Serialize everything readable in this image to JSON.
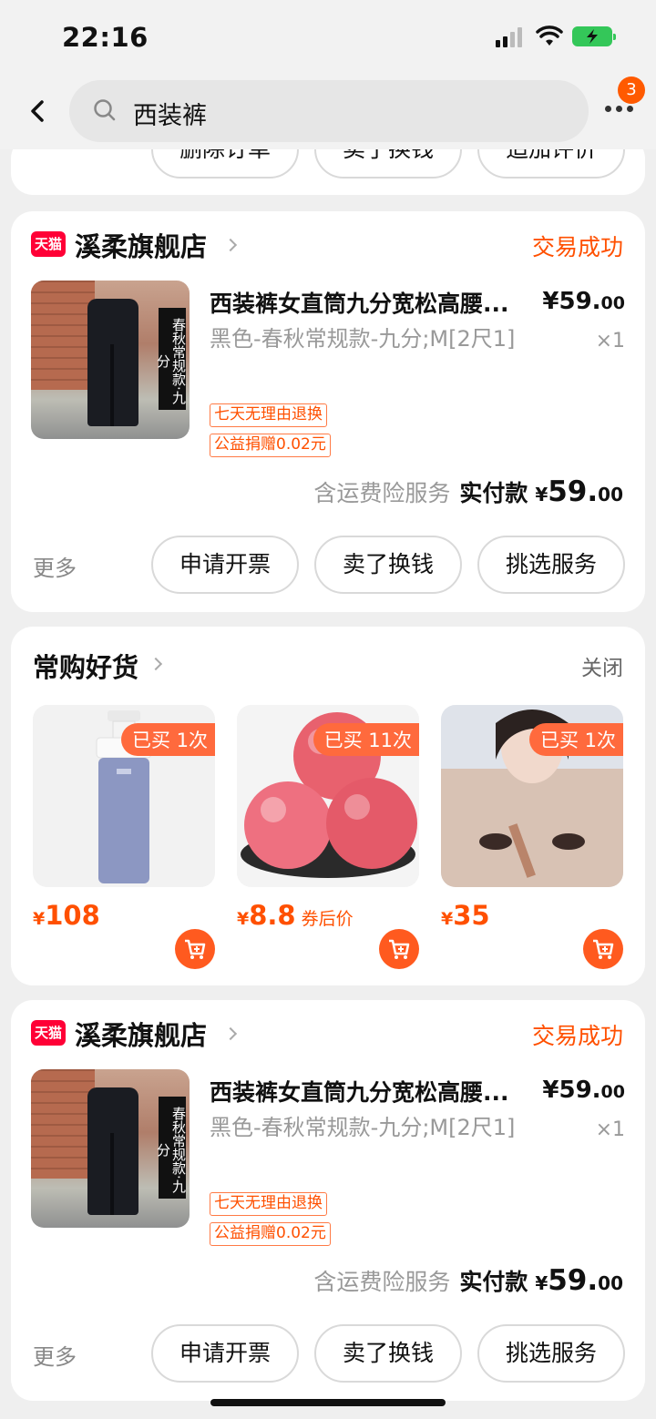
{
  "status_bar": {
    "time": "22:16"
  },
  "header": {
    "search_text": "西装裤",
    "notification_count": "3"
  },
  "prev_card": {
    "buttons": [
      "删除订单",
      "卖了换钱",
      "追加评价"
    ]
  },
  "orders": [
    {
      "shop_badge": "天猫",
      "shop_name": "溪柔旗舰店",
      "status": "交易成功",
      "thumb_tag": "春秋常规款·九分",
      "title": "西装裤女直筒九分宽松高腰...",
      "price_int": "¥59.",
      "price_dec": "00",
      "spec": "黑色-春秋常规款-九分;M[2尺1]",
      "qty": "×1",
      "tags": [
        "七天无理由退换",
        "公益捐赠0.02元"
      ],
      "insurance": "含运费险服务",
      "paid_label": "实付款",
      "paid_yen": "¥",
      "paid_int": "59.",
      "paid_dec": "00",
      "more": "更多",
      "buttons": [
        "申请开票",
        "卖了换钱",
        "挑选服务"
      ]
    },
    {
      "shop_badge": "天猫",
      "shop_name": "溪柔旗舰店",
      "status": "交易成功",
      "thumb_tag": "春秋常规款·九分",
      "title": "西装裤女直筒九分宽松高腰...",
      "price_int": "¥59.",
      "price_dec": "00",
      "spec": "黑色-春秋常规款-九分;M[2尺1]",
      "qty": "×1",
      "tags": [
        "七天无理由退换",
        "公益捐赠0.02元"
      ],
      "insurance": "含运费险服务",
      "paid_label": "实付款",
      "paid_yen": "¥",
      "paid_int": "59.",
      "paid_dec": "00",
      "more": "更多",
      "buttons": [
        "申请开票",
        "卖了换钱",
        "挑选服务"
      ]
    }
  ],
  "recommend": {
    "title": "常购好货",
    "close": "关闭",
    "items": [
      {
        "bought": "已买 1次",
        "yen": "¥",
        "price": "108",
        "sub": ""
      },
      {
        "bought": "已买 11次",
        "yen": "¥",
        "price": "8.8",
        "sub": "券后价"
      },
      {
        "bought": "已买 1次",
        "yen": "¥",
        "price": "35",
        "sub": ""
      }
    ]
  },
  "colors": {
    "accent": "#ff5000",
    "tmall": "#ff0036",
    "background": "#efefef"
  }
}
